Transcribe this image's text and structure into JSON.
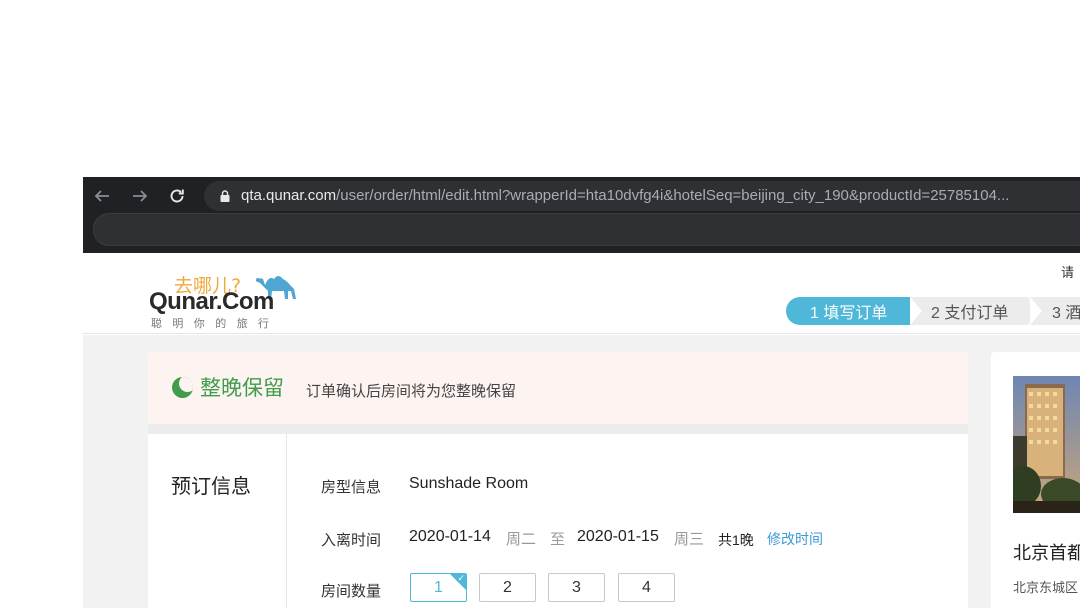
{
  "browser": {
    "url_host": "qta.qunar.com",
    "url_path": "/user/order/html/edit.html?wrapperId=hta10dvfg4i&hotelSeq=beijing_city_190&productId=25785104..."
  },
  "logo": {
    "cn_text": "去哪儿?",
    "en_text": "Qunar.Com",
    "slogan": "聪明你的旅行"
  },
  "header": {
    "right_text": "请"
  },
  "steps": [
    {
      "label": "1 填写订单",
      "active": true
    },
    {
      "label": "2 支付订单",
      "active": false
    },
    {
      "label": "3 酒",
      "active": false
    }
  ],
  "notice": {
    "title": "整晚保留",
    "description": "订单确认后房间将为您整晚保留"
  },
  "booking": {
    "section_title": "预订信息",
    "room_type_label": "房型信息",
    "room_type_value": "Sunshade Room",
    "stay_label": "入离时间",
    "checkin_date": "2020-01-14",
    "checkin_weekday": "周二",
    "to_word": "至",
    "checkout_date": "2020-01-15",
    "checkout_weekday": "周三",
    "nights": "共1晚",
    "modify_link": "修改时间",
    "rooms_label": "房间数量",
    "room_counts": [
      "1",
      "2",
      "3",
      "4"
    ],
    "selected_room_count": "1"
  },
  "hotel": {
    "name": "北京首都",
    "address": "北京东城区"
  },
  "colors": {
    "accent": "#4fb8d8",
    "notice_green": "#3f9d4c",
    "link": "#3a9bd5"
  }
}
